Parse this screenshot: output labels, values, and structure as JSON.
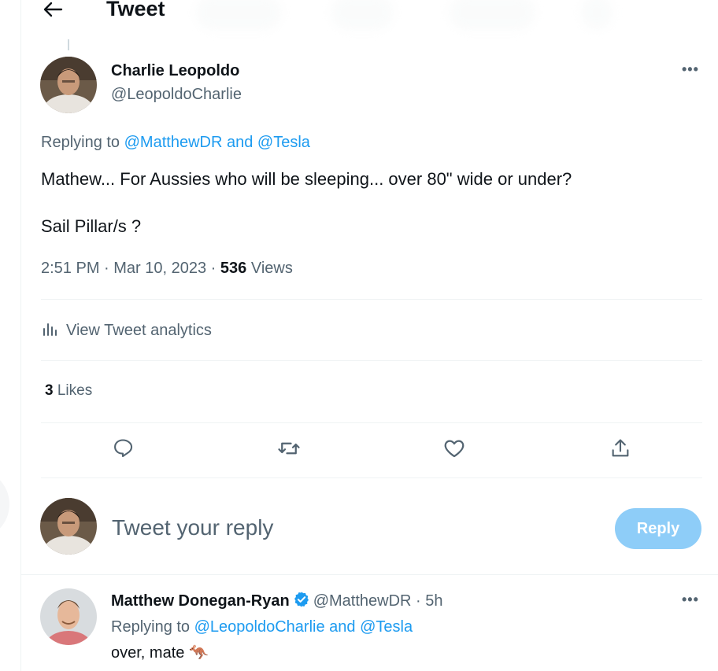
{
  "header": {
    "title": "Tweet"
  },
  "tweet": {
    "author_name": "Charlie Leopoldo",
    "author_handle": "@LeopoldoCharlie",
    "replying_prefix": "Replying to ",
    "replying_to_1": "@MatthewDR",
    "replying_and": " and ",
    "replying_to_2": "@Tesla",
    "text_line_1": "Mathew... For Aussies who will be sleeping... over 80\" wide or under?",
    "text_line_2": "Sail Pillar/s ?",
    "time": "2:51 PM",
    "sep": " · ",
    "date": "Mar 10, 2023",
    "views_count": "536",
    "views_label": " Views",
    "analytics_label": "View Tweet analytics",
    "likes_count": "3",
    "likes_label": " Likes",
    "more_label": "•••"
  },
  "actions": {
    "reply_icon": "comment-icon",
    "retweet_icon": "retweet-icon",
    "like_icon": "heart-icon",
    "share_icon": "share-icon"
  },
  "compose": {
    "placeholder": "Tweet your reply",
    "reply_button": "Reply"
  },
  "reply": {
    "author_name": "Matthew Donegan-Ryan",
    "author_handle": "@MatthewDR",
    "time_sep": " · ",
    "time": "5h",
    "replying_prefix": "Replying to ",
    "replying_to_1": "@LeopoldoCharlie",
    "replying_and": " and ",
    "replying_to_2": "@Tesla",
    "text": "over, mate ",
    "emoji": "🦘",
    "more_label": "•••"
  },
  "colors": {
    "accent": "#1d9bf0",
    "reply_button": "#8ecdf8",
    "secondary_text": "#536471",
    "primary_text": "#0f1419",
    "divider": "#eff3f4"
  }
}
